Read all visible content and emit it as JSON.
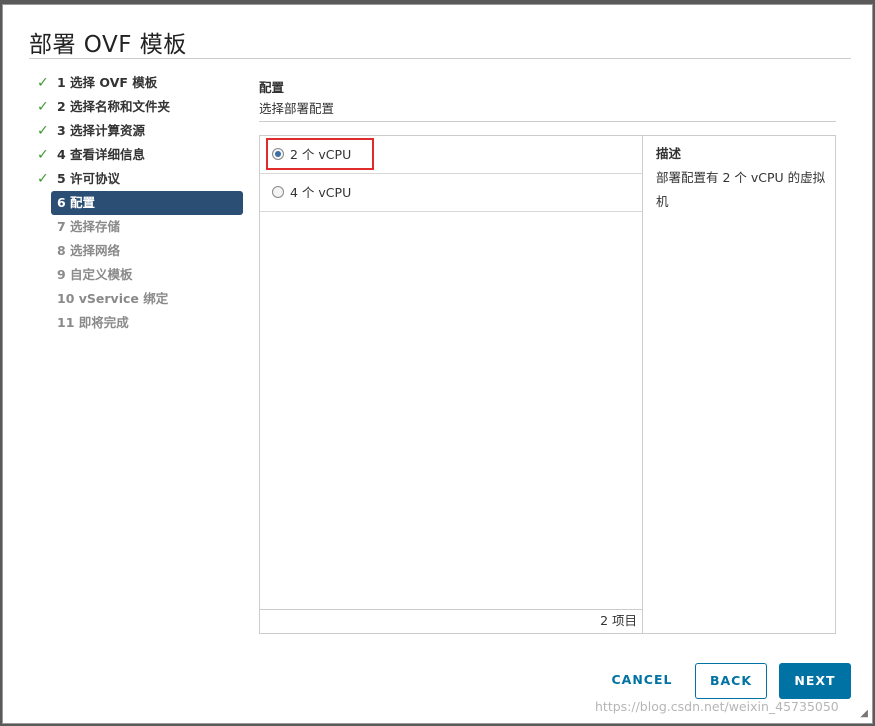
{
  "dialog": {
    "title": "部署 OVF 模板"
  },
  "steps": [
    {
      "label": "1 选择 OVF 模板",
      "state": "done"
    },
    {
      "label": "2 选择名称和文件夹",
      "state": "done"
    },
    {
      "label": "3 选择计算资源",
      "state": "done"
    },
    {
      "label": "4 查看详细信息",
      "state": "done"
    },
    {
      "label": "5 许可协议",
      "state": "done"
    },
    {
      "label": "6 配置",
      "state": "active"
    },
    {
      "label": "7 选择存储",
      "state": "pending"
    },
    {
      "label": "8 选择网络",
      "state": "pending"
    },
    {
      "label": "9 自定义模板",
      "state": "pending"
    },
    {
      "label": "10 vService 绑定",
      "state": "pending"
    },
    {
      "label": "11 即将完成",
      "state": "pending"
    }
  ],
  "main": {
    "title": "配置",
    "subtitle": "选择部署配置",
    "options": [
      {
        "label": "2 个 vCPU",
        "selected": true
      },
      {
        "label": "4 个 vCPU",
        "selected": false
      }
    ],
    "footer_count": "2 项目",
    "description_title": "描述",
    "description_text": "部署配置有 2 个 vCPU 的虚拟机"
  },
  "buttons": {
    "cancel": "CANCEL",
    "back": "BACK",
    "next": "NEXT"
  },
  "watermark": "https://blog.csdn.net/weixin_45735050",
  "colors": {
    "accent": "#0072a3",
    "active_step": "#2b4f74",
    "check": "#3a9a2c",
    "highlight": "#e02b2b"
  }
}
